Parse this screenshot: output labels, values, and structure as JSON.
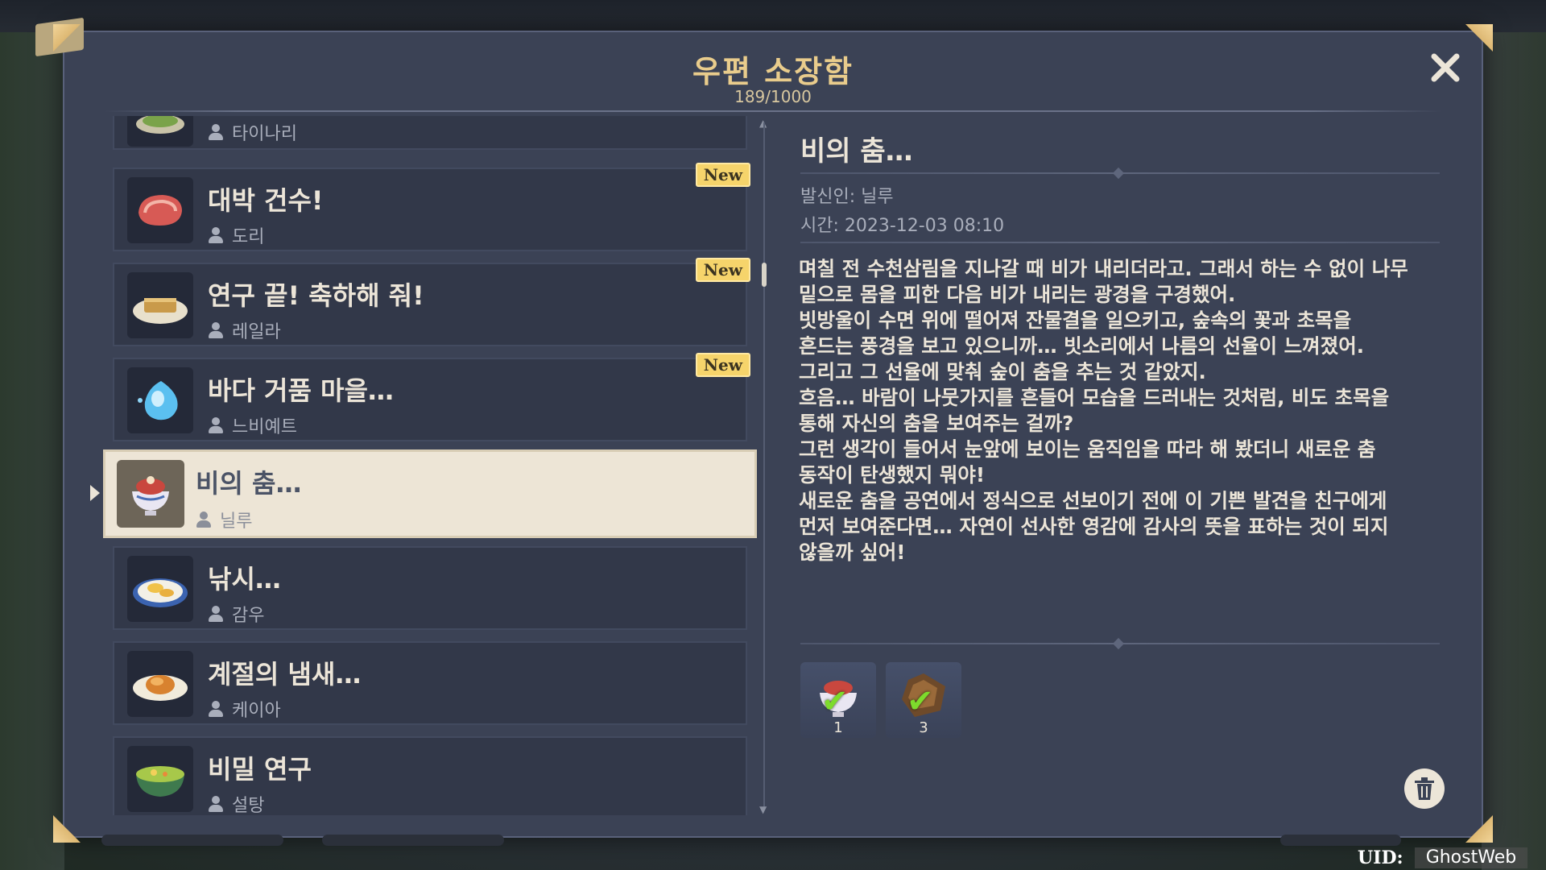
{
  "window": {
    "title": "우편 소장함",
    "count": "189/1000"
  },
  "mails": [
    {
      "title": "",
      "sender": "타이나리",
      "icon": "salad-icon",
      "new": false,
      "partial": true
    },
    {
      "title": "대박 건수!",
      "sender": "도리",
      "icon": "meat-icon",
      "new": true
    },
    {
      "title": "연구 끝! 축하해 줘!",
      "sender": "레일라",
      "icon": "pastry-icon",
      "new": true
    },
    {
      "title": "바다 거품 마을…",
      "sender": "느비예트",
      "icon": "water-drop-icon",
      "new": true
    },
    {
      "title": "비의 춤…",
      "sender": "닐루",
      "icon": "dessert-bowl-icon",
      "new": false,
      "selected": true
    },
    {
      "title": "낚시…",
      "sender": "감우",
      "icon": "fish-dish-icon",
      "new": false
    },
    {
      "title": "계절의 냄새…",
      "sender": "케이아",
      "icon": "roast-dish-icon",
      "new": false
    },
    {
      "title": "비밀 연구",
      "sender": "설탕",
      "icon": "soup-dish-icon",
      "new": false
    }
  ],
  "new_label": "New",
  "detail": {
    "title": "비의 춤…",
    "sender_line": "발신인: 닐루",
    "time_line": "시간: 2023-12-03 08:10",
    "body": [
      "며칠 전 수천삼림을 지나갈 때 비가 내리더라고. 그래서 하는 수 없이 나무",
      "밑으로 몸을 피한 다음 비가 내리는 광경을 구경했어.",
      "빗방울이 수면 위에 떨어져 잔물결을 일으키고, 숲속의 꽃과 초목을",
      "흔드는 풍경을 보고 있으니까… 빗소리에서 나름의 선율이 느껴졌어.",
      "그리고 그 선율에 맞춰 숲이 춤을 추는 것 같았지.",
      "흐음… 바람이 나뭇가지를 흔들어 모습을 드러내는 것처럼, 비도 초목을",
      "통해 자신의 춤을 보여주는 걸까?",
      "그런 생각이 들어서 눈앞에 보이는 움직임을 따라 해 봤더니 새로운 춤",
      "동작이 탄생했지 뭐야!",
      "새로운 춤을 공연에서 정식으로 선보이기 전에 이 기쁜 발견을 친구에게",
      "먼저 보여준다면… 자연이 선사한 영감에 감사의 뜻을 표하는 것이 되지",
      "않을까 싶어!"
    ],
    "attachments": [
      {
        "icon": "dessert-bowl-icon",
        "qty": "1",
        "claimed": true
      },
      {
        "icon": "hero-wit-book-icon",
        "qty": "3",
        "claimed": true
      }
    ]
  },
  "uid": {
    "label": "UID:",
    "value": "GhostWeb"
  },
  "colors": {
    "panel": "#3b4255",
    "item_bg": "#323849",
    "selected_bg": "#ede5d6",
    "title_gold": "#e9cc8c",
    "badge": "#f6d46b",
    "check": "#7ddb2c"
  }
}
